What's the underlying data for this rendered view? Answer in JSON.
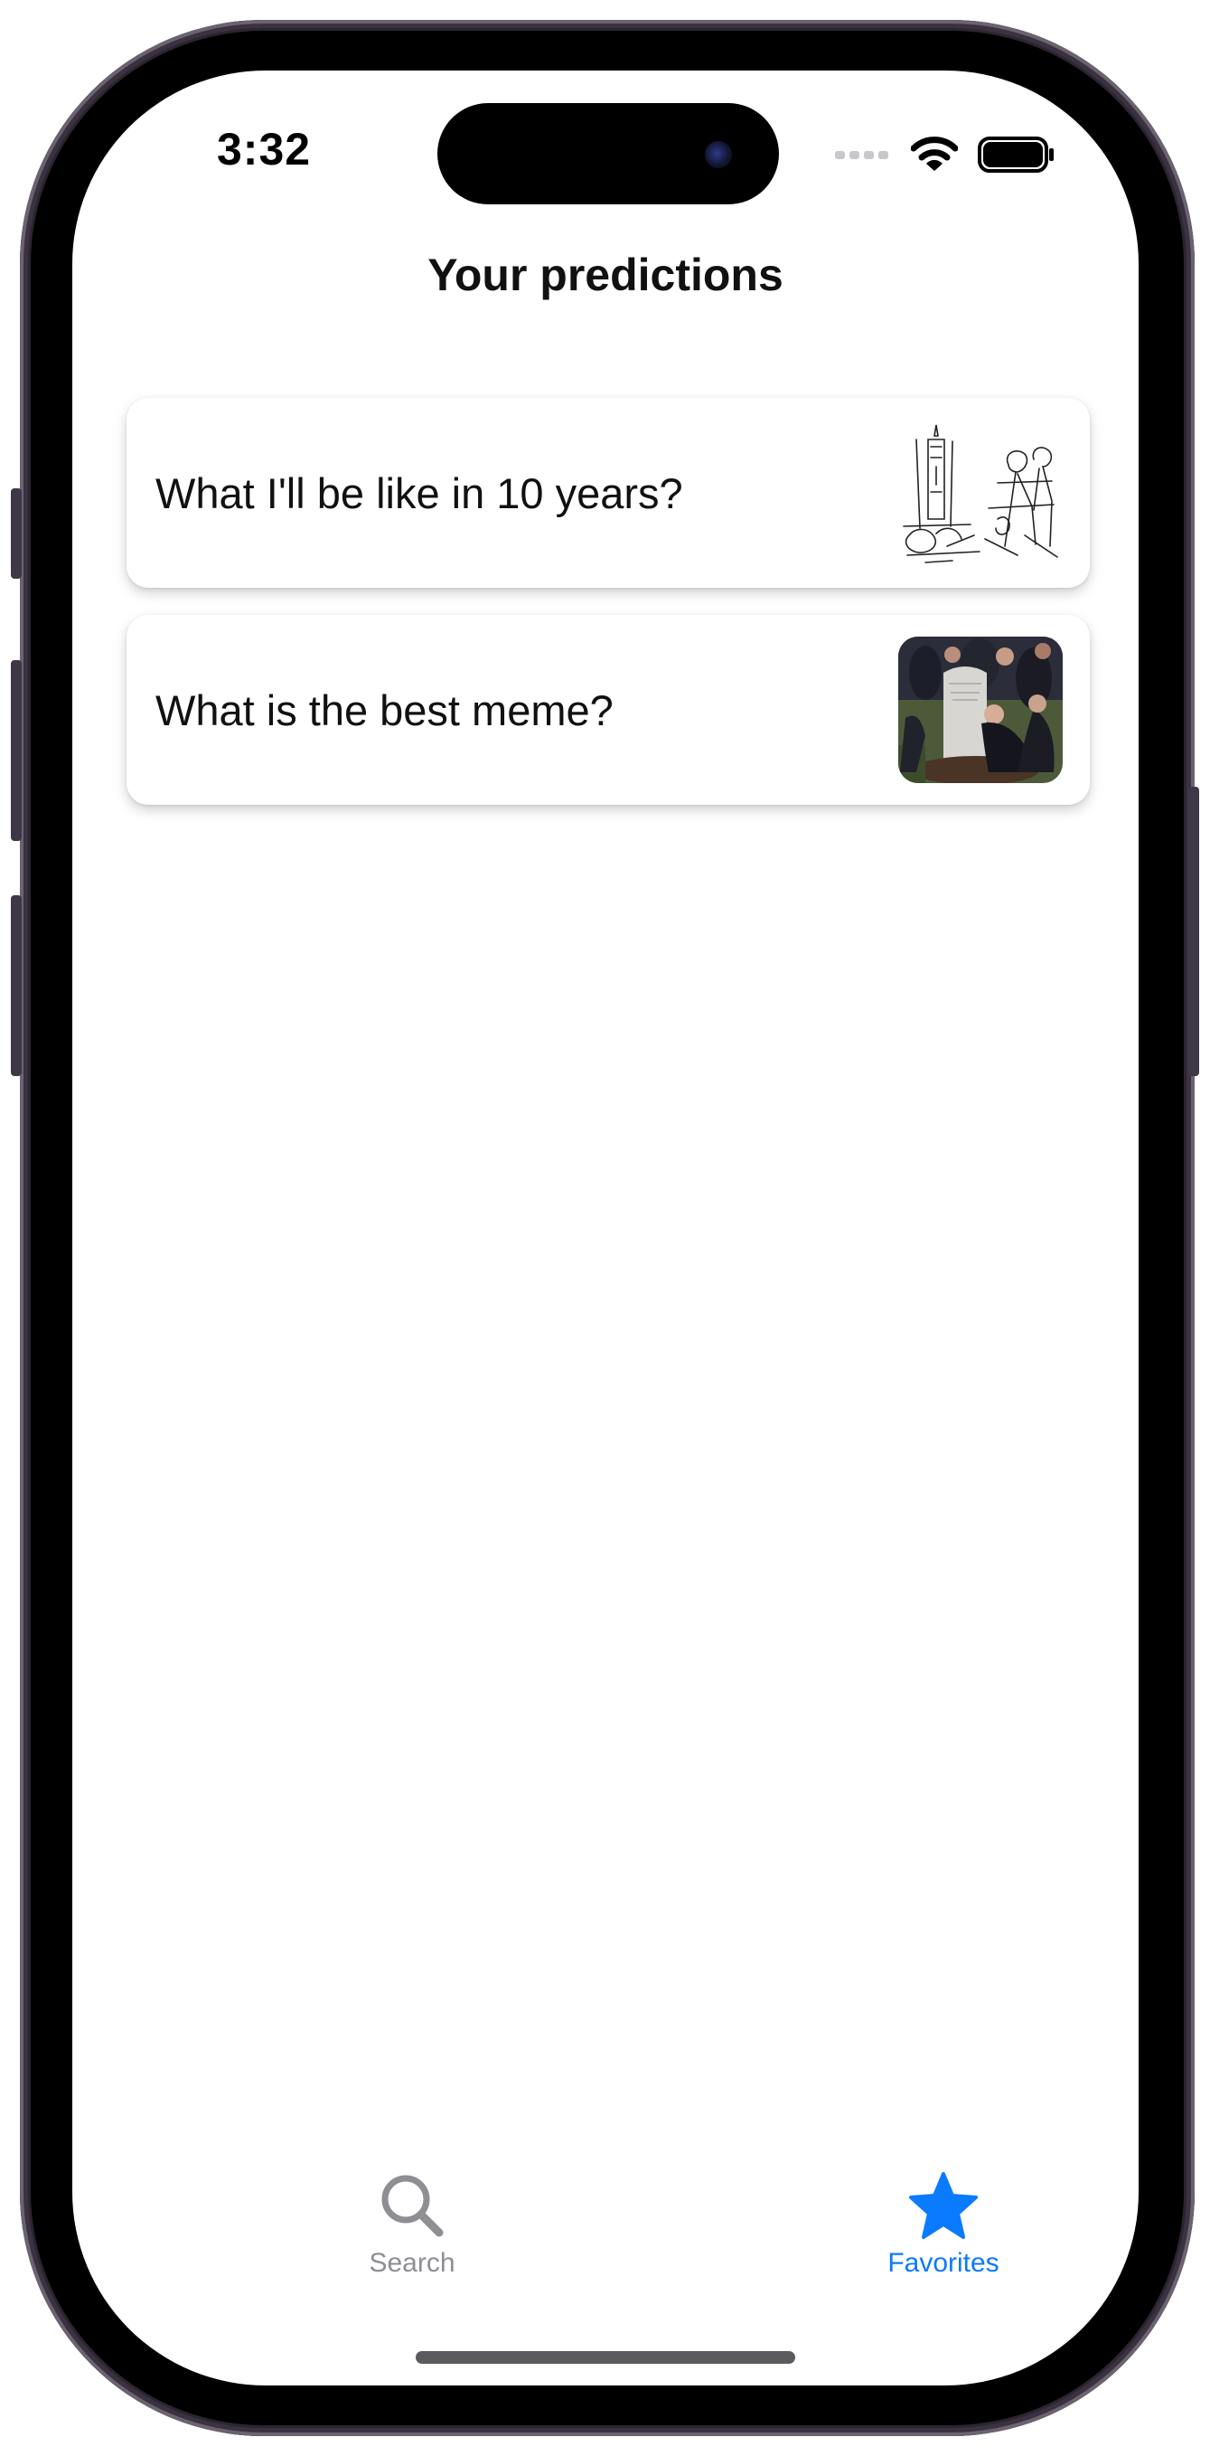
{
  "status_bar": {
    "time": "3:32"
  },
  "page": {
    "title": "Your predictions"
  },
  "predictions": [
    {
      "title": "What I'll be like in 10 years?",
      "thumbnail": "sketch-drawing"
    },
    {
      "title": "What is the best meme?",
      "thumbnail": "grave-meme-photo"
    }
  ],
  "tabbar": {
    "tabs": [
      {
        "label": "Search",
        "icon": "search-icon",
        "selected": false
      },
      {
        "label": "Favorites",
        "icon": "star-icon",
        "selected": true
      }
    ]
  },
  "colors": {
    "accent": "#0a7aff",
    "inactive": "#8e8e93",
    "background": "#ffffff"
  }
}
